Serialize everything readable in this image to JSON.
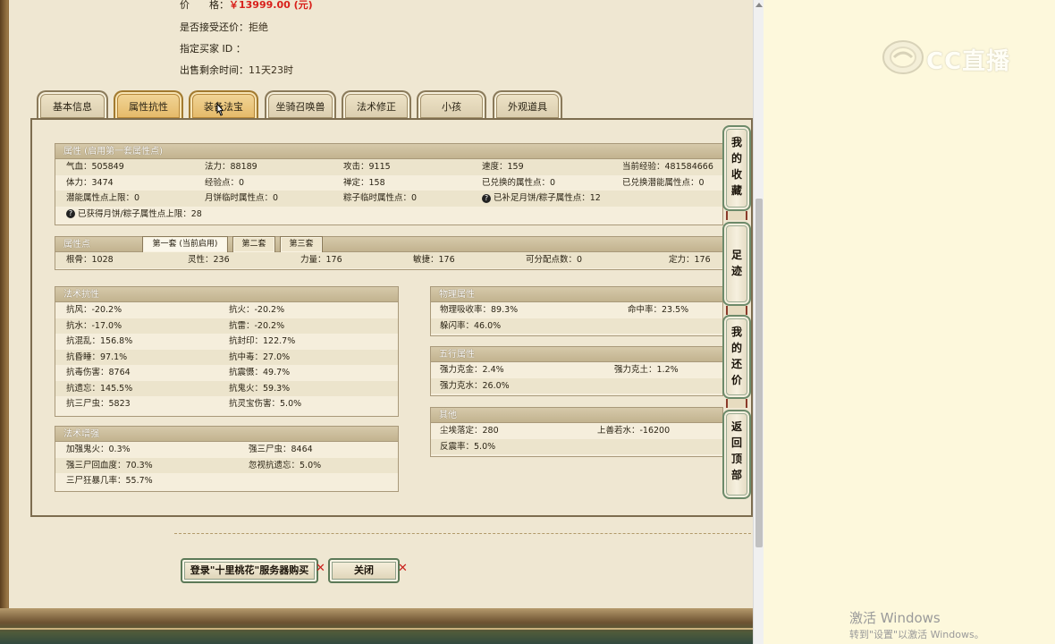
{
  "listing": {
    "price_label": "价　　格：",
    "price_value": "￥13999.00 (元)",
    "counter_label": "是否接受还价：",
    "counter_value": "拒绝",
    "buyer_label": "指定买家 ID ：",
    "time_label": "出售剩余时间：",
    "time_value": "11天23时"
  },
  "tabs": [
    "基本信息",
    "属性抗性",
    "装备法宝",
    "坐骑召唤兽",
    "法术修正",
    "小孩",
    "外观道具"
  ],
  "active_tab": 1,
  "attributes": {
    "title": "属性 (启用第一套属性点)",
    "rows": [
      [
        "气血：505849",
        "法力：88189",
        "攻击：9115",
        "速度：159",
        "当前经验：481584666"
      ],
      [
        "体力：3474",
        "经验点：0",
        "禅定：158",
        "已兑换的属性点：0",
        "已兑换潜能属性点：0"
      ],
      [
        "潜能属性点上限：0",
        "月饼临时属性点：0",
        "粽子临时属性点：0",
        "已补足月饼/粽子属性点：12",
        ""
      ],
      [
        "已获得月饼/粽子属性点上限：28",
        "",
        "",
        "",
        ""
      ]
    ]
  },
  "points": {
    "title": "属性点",
    "subtabs": [
      "第一套 (当前启用)",
      "第二套",
      "第三套"
    ],
    "values": [
      "根骨：1028",
      "灵性：236",
      "力量：176",
      "敏捷：176",
      "可分配点数：0",
      "定力：176"
    ]
  },
  "resist": {
    "title": "法术抗性",
    "rows": [
      [
        "抗风：-20.2%",
        "抗火：-20.2%"
      ],
      [
        "抗水：-17.0%",
        "抗雷：-20.2%"
      ],
      [
        "抗混乱：156.8%",
        "抗封印：122.7%"
      ],
      [
        "抗昏睡：97.1%",
        "抗中毒：27.0%"
      ],
      [
        "抗毒伤害：8764",
        "抗震慑：49.7%"
      ],
      [
        "抗遗忘：145.5%",
        "抗鬼火：59.3%"
      ],
      [
        "抗三尸虫：5823",
        "抗灵宝伤害：5.0%"
      ]
    ]
  },
  "enhance": {
    "title": "法术增强",
    "rows": [
      [
        "加强鬼火：0.3%",
        "强三尸虫：8464"
      ],
      [
        "强三尸回血度：70.3%",
        "忽视抗遗忘：5.0%"
      ],
      [
        "三尸狂暴几率：55.7%",
        ""
      ]
    ]
  },
  "physical": {
    "title": "物理属性",
    "rows": [
      [
        "物理吸收率：89.3%",
        "命中率：23.5%"
      ],
      [
        "躲闪率：46.0%",
        ""
      ]
    ]
  },
  "five_elements": {
    "title": "五行属性",
    "rows": [
      [
        "强力克金：2.4%",
        "强力克土：1.2%"
      ],
      [
        "强力克水：26.0%",
        ""
      ]
    ]
  },
  "other": {
    "title": "其他",
    "rows": [
      [
        "尘埃落定：280",
        "上善若水：-16200"
      ],
      [
        "反震率：5.0%",
        ""
      ]
    ]
  },
  "side_buttons": [
    "我的收藏",
    "足迹",
    "我的还价",
    "返回顶部"
  ],
  "actions": {
    "login_buy": "登录\"十里桃花\"服务器购买",
    "close": "关闭"
  },
  "watermark": {
    "brand": "CC直播",
    "win_line1": "激活 Windows",
    "win_line2": "转到\"设置\"以激活 Windows。"
  },
  "colors": {
    "price": "#d8201b",
    "active_tab": "#e4b865",
    "side_border": "#6d8a6a"
  }
}
